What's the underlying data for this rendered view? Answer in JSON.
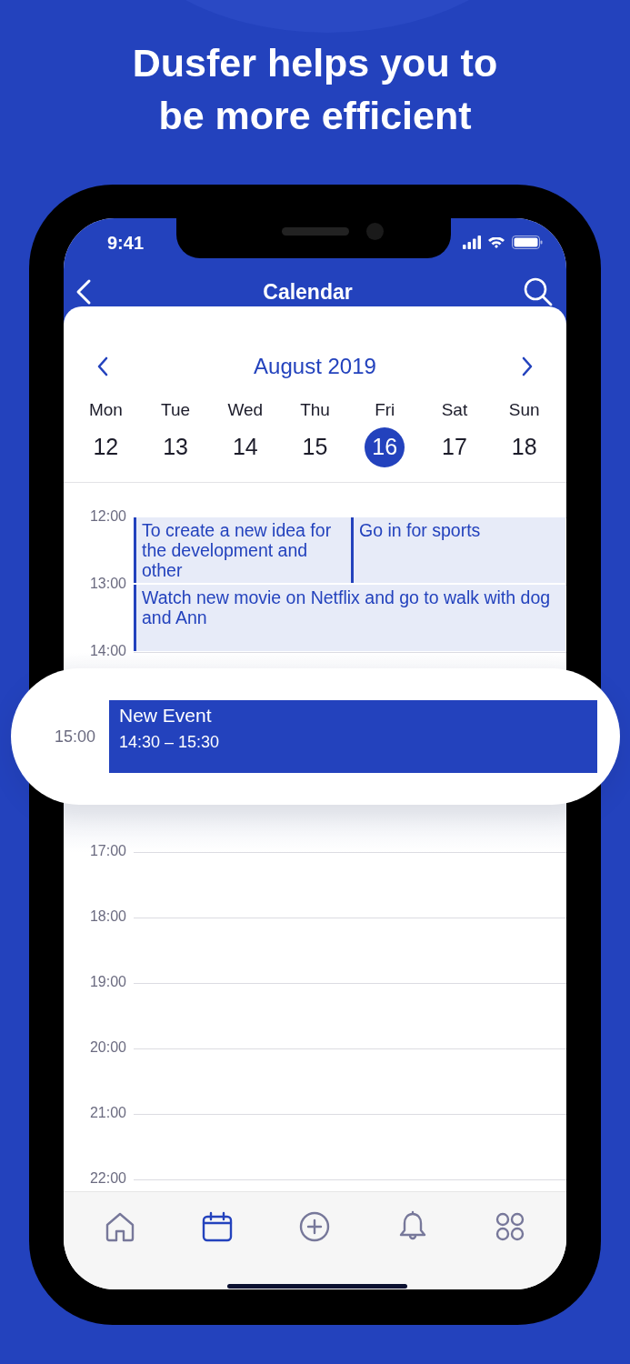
{
  "headline": "Dusfer helps you to be more efficient",
  "status_bar": {
    "time": "9:41"
  },
  "header": {
    "title": "Calendar"
  },
  "month": {
    "label": "August 2019"
  },
  "days": [
    {
      "name": "Mon",
      "date": "12",
      "selected": false
    },
    {
      "name": "Tue",
      "date": "13",
      "selected": false
    },
    {
      "name": "Wed",
      "date": "14",
      "selected": false
    },
    {
      "name": "Thu",
      "date": "15",
      "selected": false
    },
    {
      "name": "Fri",
      "date": "16",
      "selected": true
    },
    {
      "name": "Sat",
      "date": "17",
      "selected": false
    },
    {
      "name": "Sun",
      "date": "18",
      "selected": false
    }
  ],
  "timeline": {
    "hours_above": [
      "12:00",
      "13:00",
      "14:00"
    ],
    "hours_below": [
      "17:00",
      "18:00",
      "19:00",
      "20:00",
      "21:00",
      "22:00"
    ]
  },
  "events": [
    {
      "title": "To create a new idea for the development and other"
    },
    {
      "title": "Go in for sports"
    },
    {
      "title": "Watch new movie on Netflix and go to walk with dog and Ann"
    }
  ],
  "new_event": {
    "hour": "15:00",
    "title": "New Event",
    "time": "14:30 – 15:30"
  },
  "tab_bar": [
    {
      "kind": "home",
      "selected": false
    },
    {
      "kind": "calendar",
      "selected": true
    },
    {
      "kind": "add",
      "selected": false
    },
    {
      "kind": "bell",
      "selected": false
    },
    {
      "kind": "apps",
      "selected": false
    }
  ]
}
